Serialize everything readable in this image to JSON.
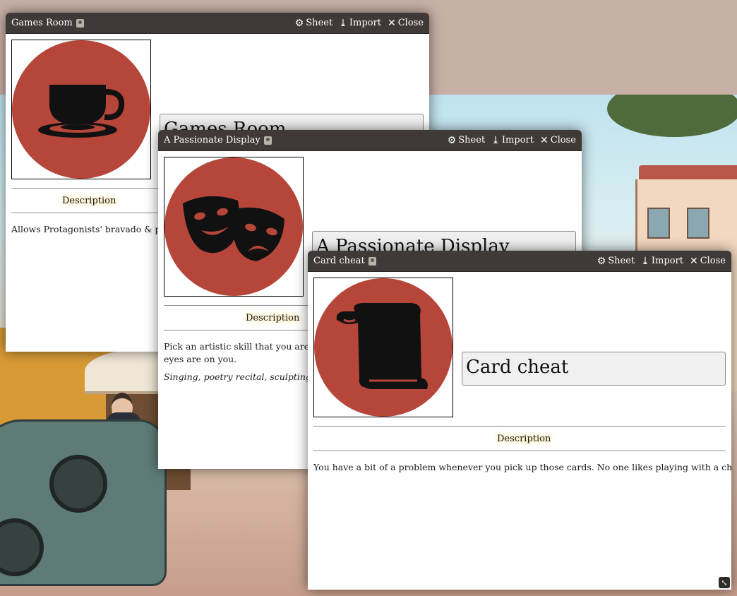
{
  "windows": [
    {
      "title": "Games Room",
      "name_value": "Games Room",
      "icon": "teacup-icon",
      "description_label": "Description",
      "description_lines": [
        "Allows Protagonists' bravado & persuas"
      ],
      "italic_line": ""
    },
    {
      "title": "A Passionate Display",
      "name_value": "A Passionate Display",
      "icon": "theater-masks-icon",
      "description_label": "Description",
      "description_lines": [
        "Pick an artistic skill that you are very p",
        "eyes are on you."
      ],
      "italic_line": "Singing, poetry recital, sculpting, harpsi"
    },
    {
      "title": "Card cheat",
      "name_value": "Card cheat",
      "icon": "scroll-icon",
      "description_label": "Description",
      "description_lines": [
        "You have a bit of a problem whenever you pick up those cards. No one likes playing with a cheater."
      ],
      "italic_line": ""
    }
  ],
  "header_buttons": {
    "sheet": "Sheet",
    "import": "Import",
    "close": "Close"
  },
  "colors": {
    "header_bg": "#3f3a37",
    "portrait_red": "#b6463a",
    "icon_black": "#111111",
    "label_glow": "#f1d07a"
  }
}
